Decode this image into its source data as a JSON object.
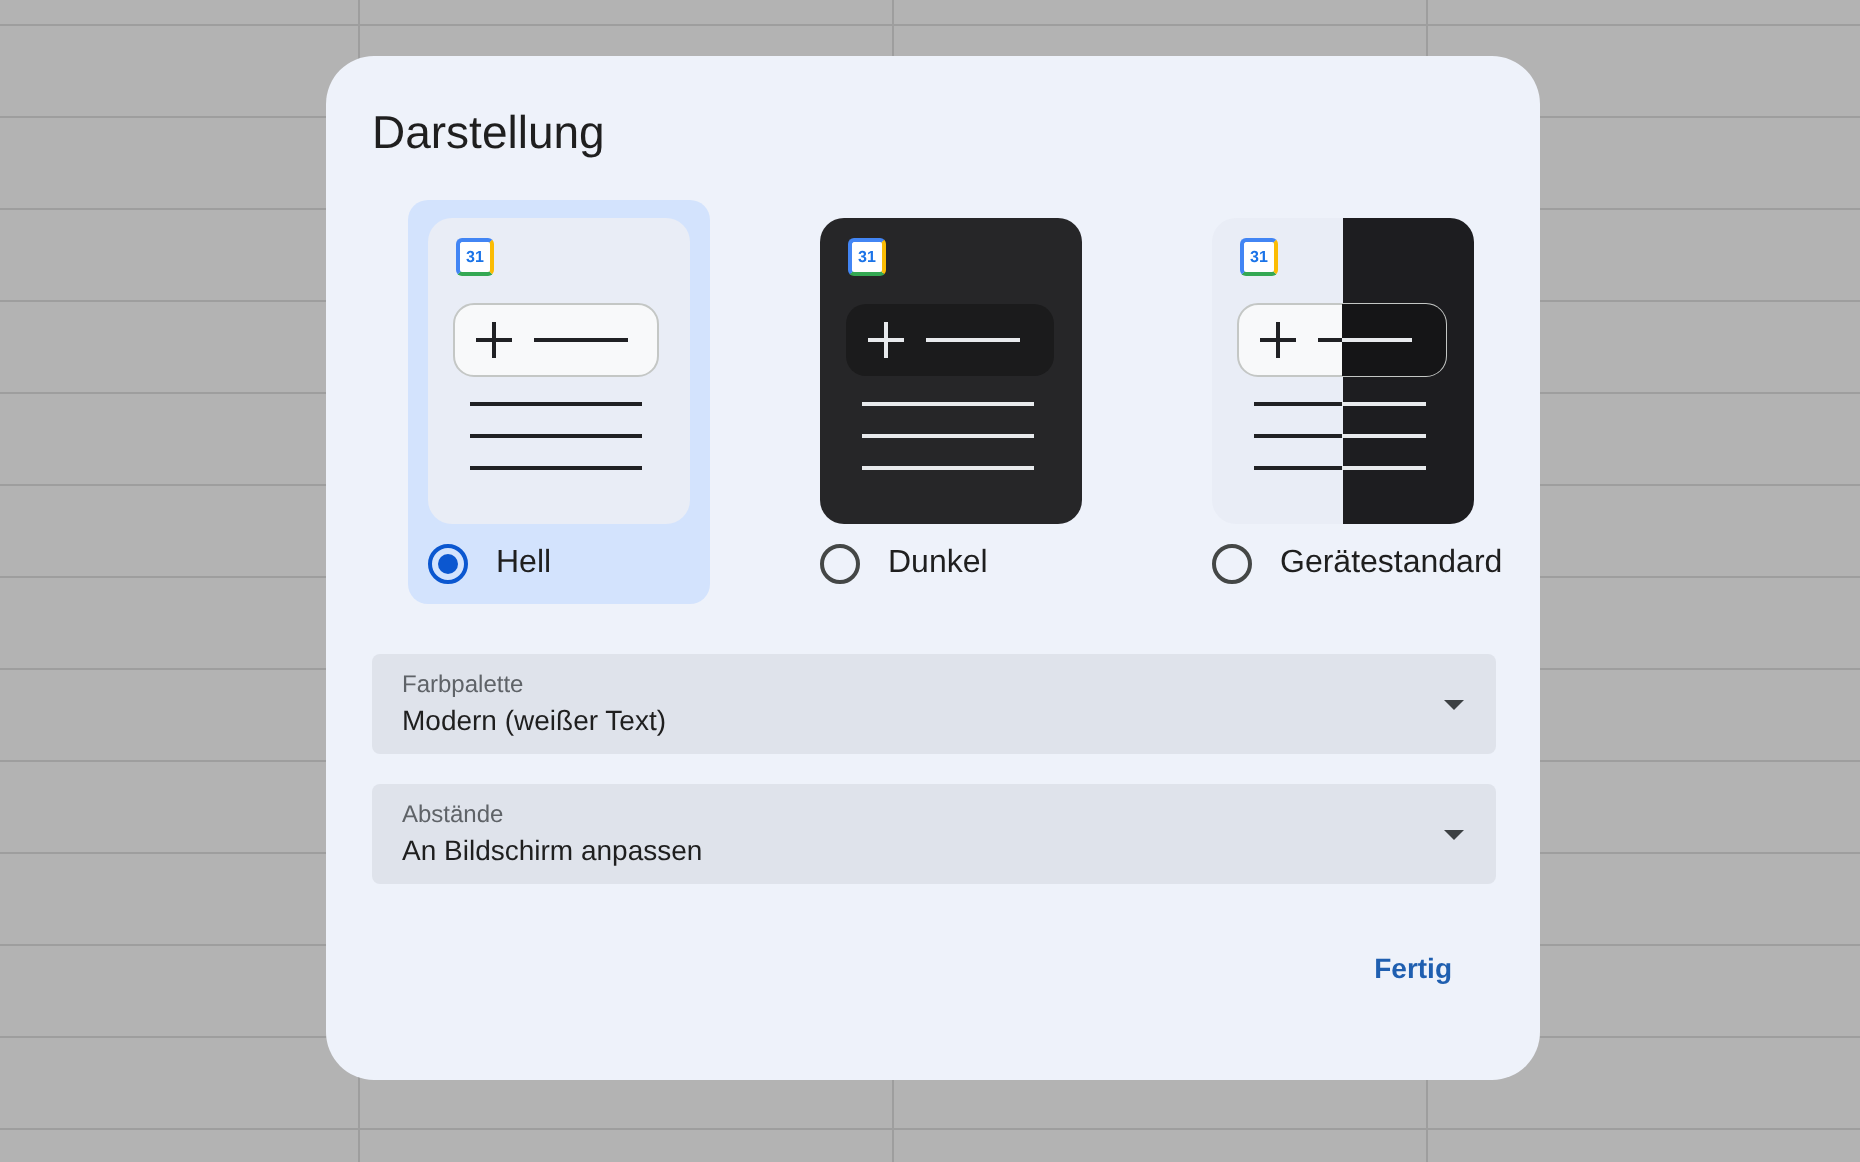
{
  "dialog": {
    "title": "Darstellung"
  },
  "themes": [
    {
      "kind": "light",
      "label": "Hell",
      "calendar_label": "31",
      "selected": true
    },
    {
      "kind": "dark",
      "label": "Dunkel",
      "calendar_label": "31",
      "selected": false
    },
    {
      "kind": "system",
      "label": "Gerätestandard",
      "calendar_label": "31",
      "selected": false
    }
  ],
  "fields": [
    {
      "label": "Farbpalette",
      "value": "Modern (weißer Text)"
    },
    {
      "label": "Abstände",
      "value": "An Bildschirm anpassen"
    }
  ],
  "buttons": [
    {
      "label": "Fertig"
    }
  ]
}
